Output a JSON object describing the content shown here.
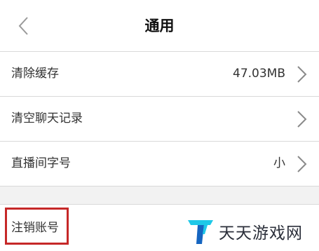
{
  "header": {
    "back_icon": "chevron-left-icon",
    "title": "通用"
  },
  "settings": {
    "clear_cache": {
      "label": "清除缓存",
      "value": "47.03MB"
    },
    "clear_chat": {
      "label": "清空聊天记录"
    },
    "font_size": {
      "label": "直播间字号",
      "value": "小"
    },
    "cancel_account": {
      "label": "注销账号"
    }
  },
  "watermark": {
    "text": "天天游戏网",
    "logo_icon": "letter-t-logo-icon"
  },
  "colors": {
    "highlight": "#c62828",
    "separator": "#d9d9d9",
    "gap_background": "#f2f2f2",
    "logo_cyan": "#1ec8e8",
    "logo_blue": "#1565c0"
  }
}
